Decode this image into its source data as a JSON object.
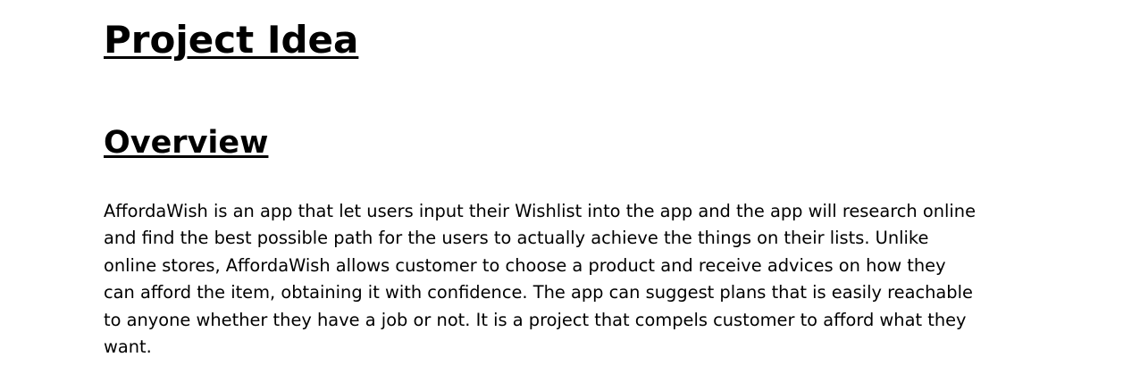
{
  "document": {
    "title": "Project Idea",
    "section_heading": "Overview",
    "paragraph_lines": [
      "AffordaWish is an app that let users input their Wishlist into the app and the app will research online",
      "and find the best possible path for the users to actually achieve the things on their lists. Unlike",
      "online stores, AffordaWish allows customer to choose a product and receive advices on how they",
      "can afford the item, obtaining it with confidence. The app can suggest plans that is easily reachable",
      "to anyone whether they have a job or not. It is a project that compels customer to afford what they",
      "want."
    ]
  }
}
